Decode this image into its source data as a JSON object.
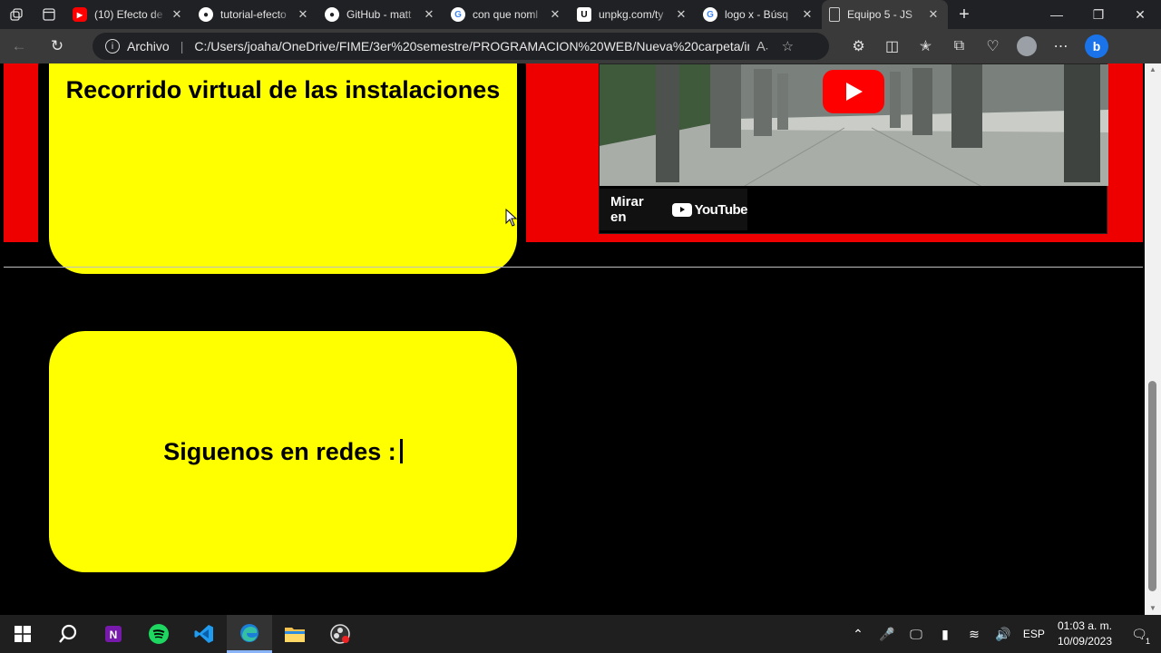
{
  "browser": {
    "tabs": [
      {
        "title": "(10) Efecto de",
        "favicon": "youtube-icon",
        "color": "#ff0000"
      },
      {
        "title": "tutorial-efecto",
        "favicon": "github-icon",
        "color": "#ffffff"
      },
      {
        "title": "GitHub - matt",
        "favicon": "github-icon",
        "color": "#ffffff"
      },
      {
        "title": "con que noml",
        "favicon": "google-icon",
        "color": "#ffffff"
      },
      {
        "title": "unpkg.com/ty",
        "favicon": "unpkg-icon",
        "color": "#ffffff"
      },
      {
        "title": "logo x - Búsq",
        "favicon": "google-icon",
        "color": "#ffffff"
      },
      {
        "title": "Equipo 5 - JS",
        "favicon": "file-icon",
        "color": "#cccccc",
        "active": true
      }
    ],
    "address": {
      "label": "Archivo",
      "url": "C:/Users/joaha/OneDrive/FIME/3er%20semestre/PROGRAMACION%20WEB/Nueva%20carpeta/in..."
    }
  },
  "page": {
    "tour_title": "Recorrido virtual de las instalaciones",
    "video": {
      "watch_label": "Mirar en",
      "platform": "YouTube"
    },
    "social_title": "Siguenos en redes :"
  },
  "taskbar": {
    "language": "ESP",
    "time": "01:03 a. m.",
    "date": "10/09/2023",
    "notifications": "1"
  },
  "colors": {
    "band": "#ee0000",
    "card": "#ffff00"
  }
}
